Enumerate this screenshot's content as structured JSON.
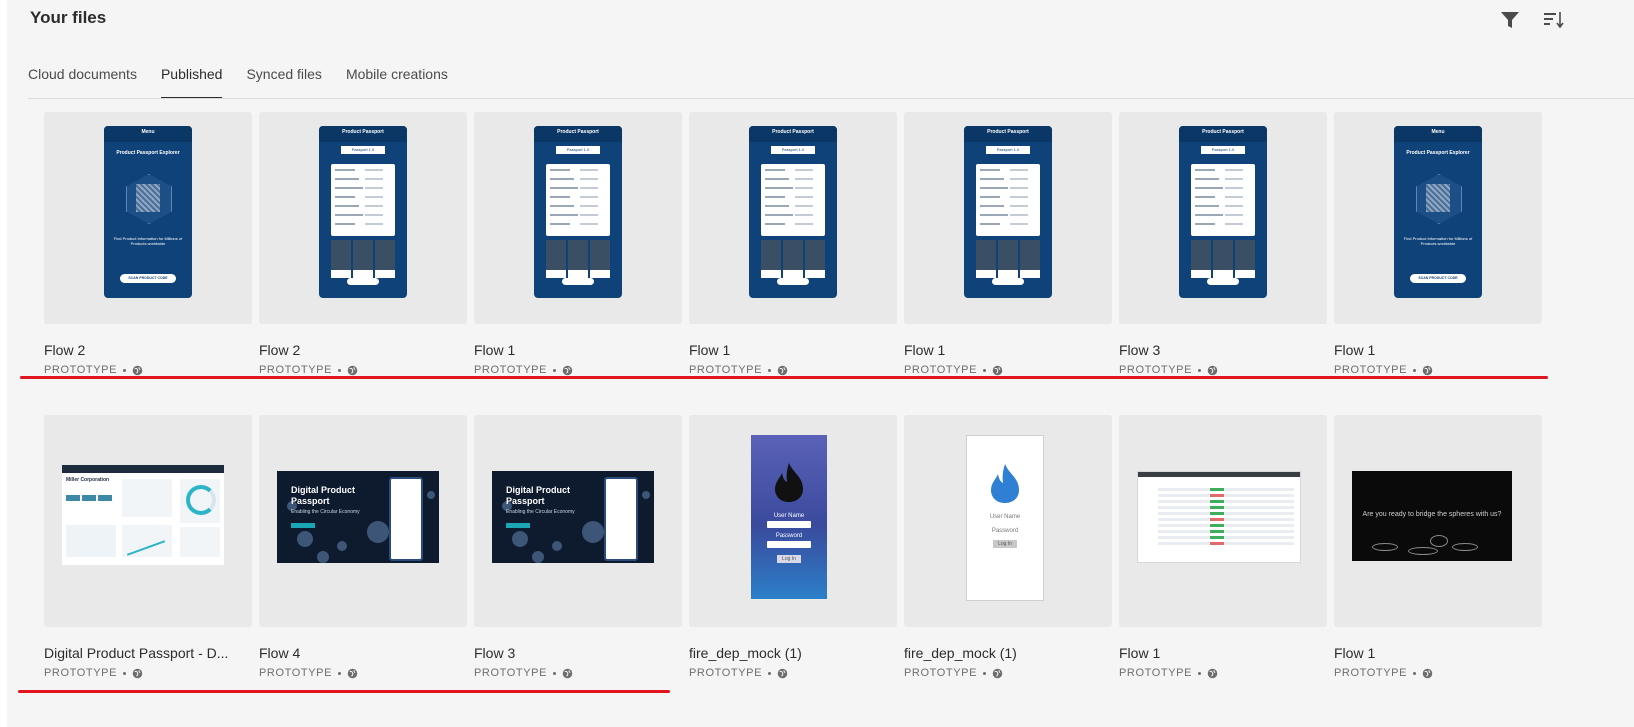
{
  "header": {
    "title": "Your files",
    "filter_icon": "filter-icon",
    "sort_icon": "sort-icon"
  },
  "tabs": [
    {
      "label": "Cloud documents",
      "active": false
    },
    {
      "label": "Published",
      "active": true
    },
    {
      "label": "Synced files",
      "active": false
    },
    {
      "label": "Mobile creations",
      "active": false
    }
  ],
  "files": [
    {
      "name": "Flow 2",
      "type": "PROTOTYPE",
      "thumb": "menu",
      "phone_title": "Menu",
      "phone_heading": "Product Passport Explorer",
      "phone_text": "Find Product Information for Millions of Products worldwide",
      "phone_button": "SCAN PRODUCT CODE"
    },
    {
      "name": "Flow 2",
      "type": "PROTOTYPE",
      "thumb": "passport",
      "phone_title": "Product Passport",
      "phone_tab": "Passport 1.0"
    },
    {
      "name": "Flow 1",
      "type": "PROTOTYPE",
      "thumb": "passport",
      "phone_title": "Product Passport",
      "phone_tab": "Passport 1.0"
    },
    {
      "name": "Flow 1",
      "type": "PROTOTYPE",
      "thumb": "passport",
      "phone_title": "Product Passport",
      "phone_tab": "Passport 1.0"
    },
    {
      "name": "Flow 1",
      "type": "PROTOTYPE",
      "thumb": "passport",
      "phone_title": "Product Passport",
      "phone_tab": "Passport 1.0"
    },
    {
      "name": "Flow 3",
      "type": "PROTOTYPE",
      "thumb": "passport",
      "phone_title": "Product Passport",
      "phone_tab": "Passport 1.0"
    },
    {
      "name": "Flow 1",
      "type": "PROTOTYPE",
      "thumb": "menu",
      "phone_title": "Menu",
      "phone_heading": "Product Passport Explorer",
      "phone_text": "Find Product Information for Millions of Products worldwide",
      "phone_button": "SCAN PRODUCT CODE"
    },
    {
      "name": "Digital Product Passport - D...",
      "type": "PROTOTYPE",
      "thumb": "dashboard",
      "dash_company": "Miller Corporation"
    },
    {
      "name": "Flow 4",
      "type": "PROTOTYPE",
      "thumb": "dpp",
      "dpp_title": "Digital Product Passport",
      "dpp_sub": "Enabling the Circular Economy"
    },
    {
      "name": "Flow 3",
      "type": "PROTOTYPE",
      "thumb": "dpp",
      "dpp_title": "Digital Product Passport",
      "dpp_sub": "Enabling the Circular Economy"
    },
    {
      "name": "fire_dep_mock (1)",
      "type": "PROTOTYPE",
      "thumb": "fire-dark",
      "fire_user": "User Name",
      "fire_pass": "Password",
      "fire_login": "Log In"
    },
    {
      "name": "fire_dep_mock (1)",
      "type": "PROTOTYPE",
      "thumb": "fire-light",
      "fire_user": "User Name",
      "fire_pass": "Password",
      "fire_login": "Log In"
    },
    {
      "name": "Flow 1",
      "type": "PROTOTYPE",
      "thumb": "table"
    },
    {
      "name": "Flow 1",
      "type": "PROTOTYPE",
      "thumb": "space",
      "space_text": "Are you ready to bridge the spheres with us?"
    }
  ],
  "colors": {
    "accent_underline": "#2c2c2c",
    "annotation_red": "#e0141e",
    "phone_blue": "#0f4278"
  }
}
